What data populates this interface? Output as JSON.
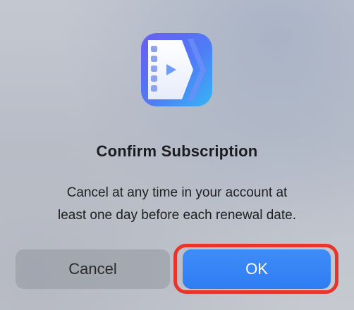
{
  "dialog": {
    "title": "Confirm Subscription",
    "message_line1": "Cancel at any time in your account at",
    "message_line2": "least one day before each renewal date.",
    "app_icon": "video-app-icon"
  },
  "buttons": {
    "cancel_label": "Cancel",
    "ok_label": "OK"
  },
  "colors": {
    "ok_button": "#2f7df4",
    "highlight_border": "#e8352c",
    "cancel_button": "#a3a8b2"
  }
}
